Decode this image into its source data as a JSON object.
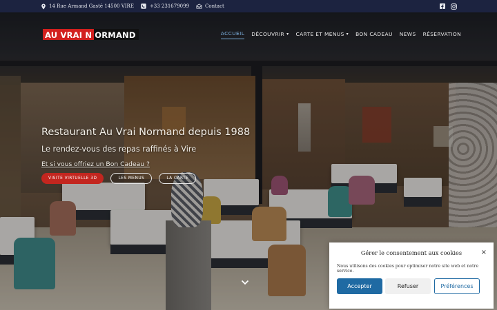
{
  "topbar": {
    "address": "14 Rue Armand Gasté 14500 VIRE",
    "phone": "+33 231679099",
    "contact": "Contact",
    "icons": [
      "location-icon",
      "phone-icon",
      "mail-icon",
      "facebook-icon",
      "instagram-icon"
    ]
  },
  "header": {
    "logo_part1": "AU VRAI N",
    "logo_part2": "ORMAND",
    "nav": [
      {
        "label": "ACCUEIL",
        "active": true
      },
      {
        "label": "DÉCOUVRIR",
        "dropdown": true
      },
      {
        "label": "CARTE ET MENUS",
        "dropdown": true
      },
      {
        "label": "BON CADEAU"
      },
      {
        "label": "NEWS"
      },
      {
        "label": "RÉSERVATION"
      }
    ]
  },
  "hero": {
    "title": "Restaurant Au Vrai Normand depuis 1988",
    "subtitle": "Le rendez-vous des repas raffinés à Vire",
    "link": "Et si vous offriez un Bon Cadeau ?",
    "buttons": [
      "VISITE VIRTUELLE 3D",
      "LES MENUS",
      "LA CARTE"
    ]
  },
  "cookie": {
    "title": "Gérer le consentement aux cookies",
    "close": "×",
    "message": "Nous utilisons des cookies pour optimiser notre site web et notre service.",
    "accept": "Accepter",
    "refuse": "Refuser",
    "preferences": "Préférences"
  },
  "colors": {
    "topbar": "#1c2340",
    "brand_red": "#c3261f",
    "accent_blue": "#1f6aa3",
    "nav_active": "#7fb6e6"
  }
}
